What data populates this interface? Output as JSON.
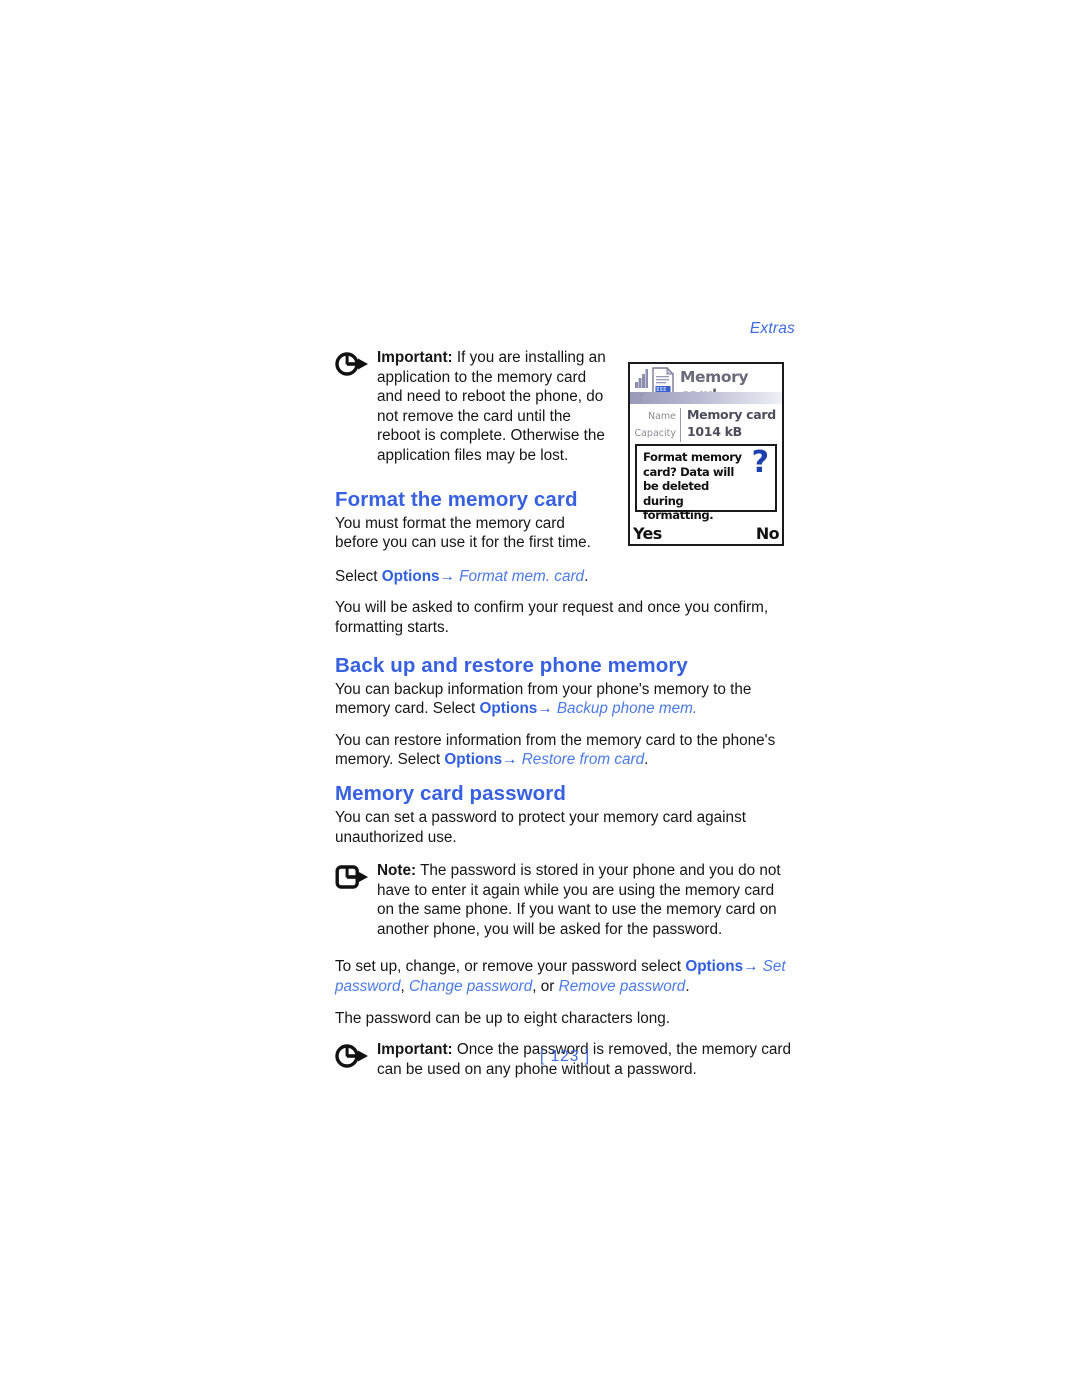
{
  "running_head": "Extras",
  "folio": "[ 123 ]",
  "callouts": {
    "important_reboot": {
      "icon": "important-arrow-icon",
      "lead": "Important:",
      "text": " If you are installing an application to the memory card and need to reboot the phone, do not remove the card until the reboot is complete. Otherwise the application files may be lost."
    },
    "note_password": {
      "icon": "note-arrow-icon",
      "lead": "Note:",
      "text": " The password is stored in your phone and you do not have to enter it again while you are using the memory card on the same phone. If you want to use the memory card on another phone, you will be asked for the password."
    },
    "important_removed": {
      "icon": "important-arrow-icon",
      "lead": "Important:",
      "text": " Once the password is removed, the memory card can be used on any phone without a password."
    }
  },
  "sections": {
    "format": {
      "heading": "Format the memory card",
      "p1": "You must format the memory card before you can use it for the first time.",
      "p2_prefix": "Select ",
      "p2_ui": "Options",
      "p2_arrow": "→",
      "p2_italic": " Format mem. card",
      "p2_suffix": ".",
      "p3": "You will be asked to confirm your request and once you confirm, formatting starts."
    },
    "backup": {
      "heading": "Back up and restore phone memory",
      "p1_prefix": "You can backup information from your phone's memory to the memory card. Select ",
      "p1_ui": "Options",
      "p1_arrow": "→",
      "p1_italic": " Backup phone mem.",
      "p2_prefix": "You can restore information from the memory card to the phone's memory. Select ",
      "p2_ui": "Options",
      "p2_arrow": "→",
      "p2_italic": " Restore from card",
      "p2_suffix": "."
    },
    "password": {
      "heading": "Memory card password",
      "p1": "You can set a password to protect your memory card against unauthorized use.",
      "p2_prefix": "To set up, change, or remove your password select ",
      "p2_ui": "Options",
      "p2_arrow": "→",
      "p2_italic1": " Set password",
      "p2_mid": ", ",
      "p2_italic2": "Change password",
      "p2_mid2": ", or ",
      "p2_italic3": "Remove password",
      "p2_suffix": ".",
      "p3": "The password can be up to eight characters long."
    }
  },
  "phone_figure": {
    "title": "Memory card",
    "rows": [
      {
        "key": "Name",
        "value": "Memory card"
      },
      {
        "key": "Capacity",
        "value": "1014 kB"
      }
    ],
    "dialog": {
      "message": "Format memory card? Data will be deleted during formatting.",
      "icon": "question-mark-icon"
    },
    "softkey_left": "Yes",
    "softkey_right": "No"
  },
  "colors": {
    "heading_blue": "#3761e0",
    "link_blue": "#4a7ae8",
    "ui_blue": "#2f5fe0",
    "body_black": "#161616",
    "phone_title_gray": "#6a6a78",
    "qmark_blue": "#1c3fb0"
  }
}
